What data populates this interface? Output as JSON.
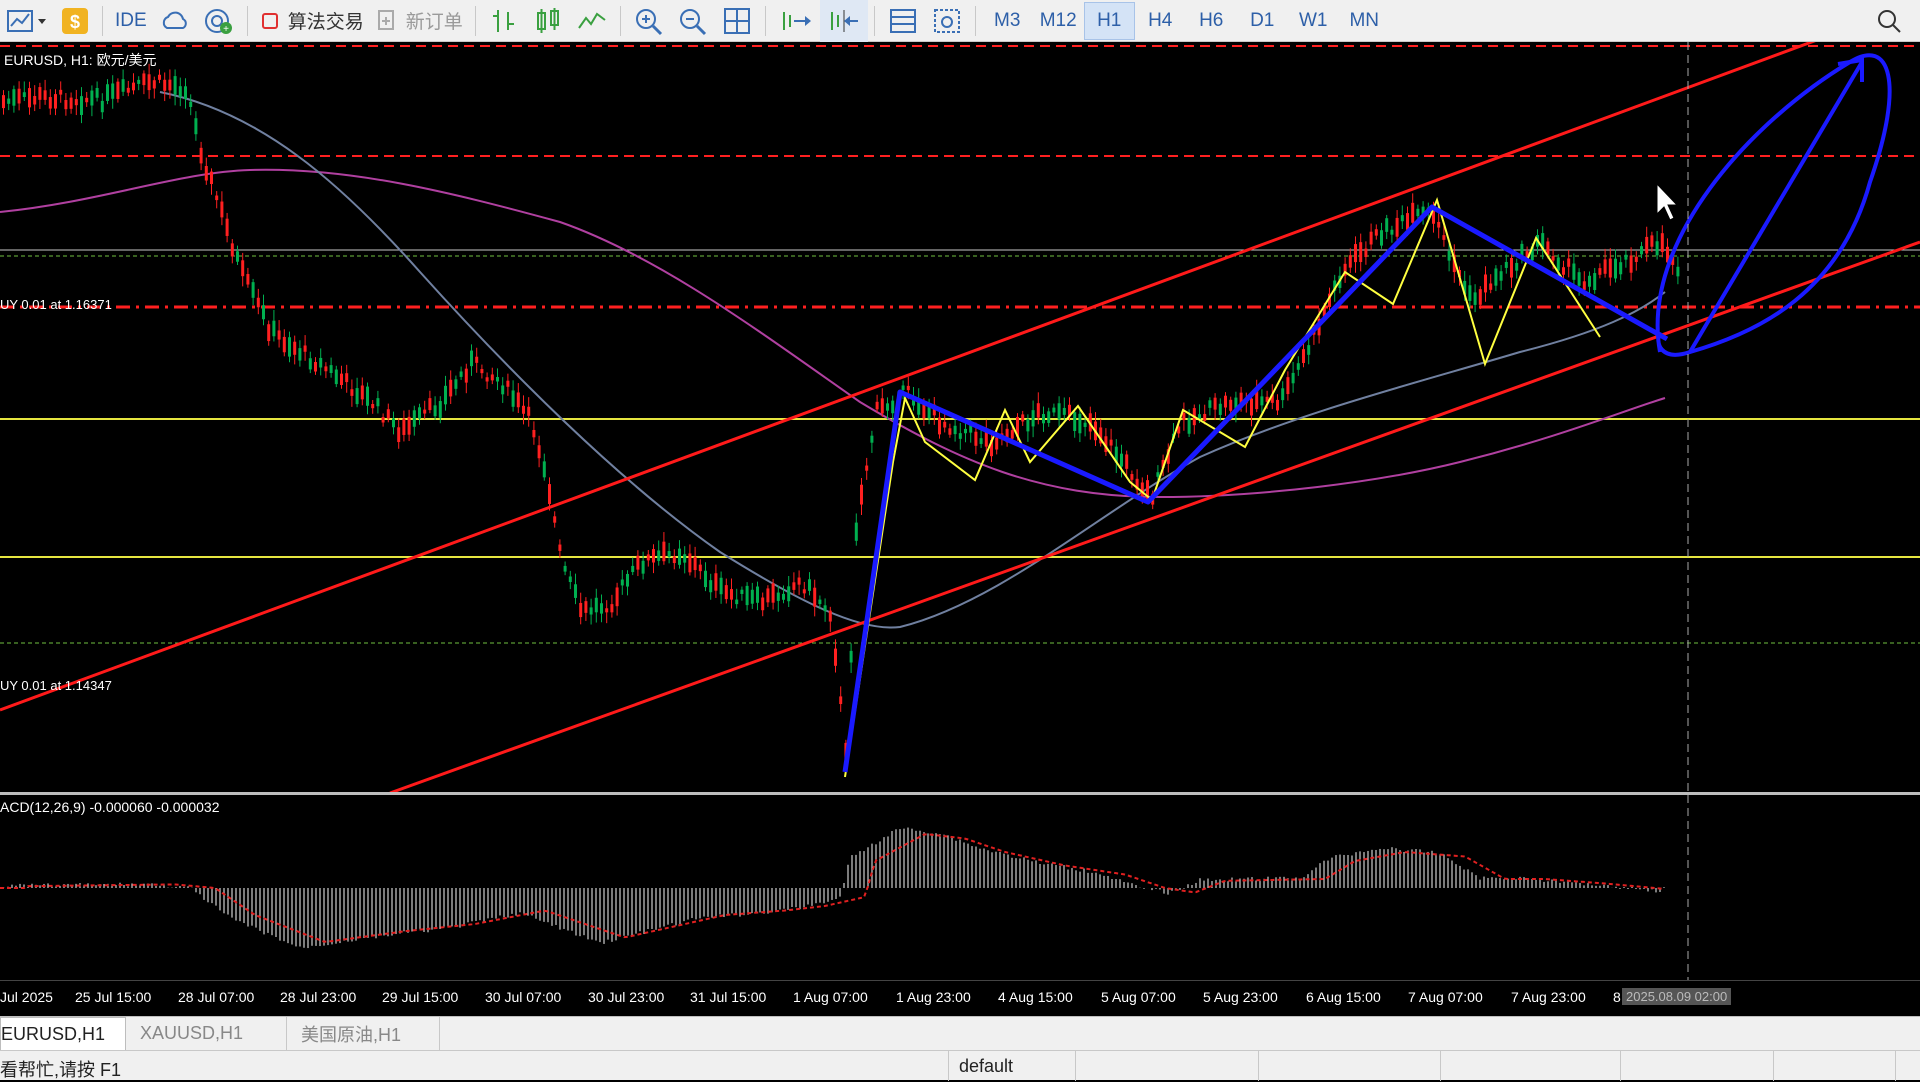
{
  "toolbar": {
    "ide_label": "IDE",
    "algo_trading_label": "算法交易",
    "new_order_label": "新订单",
    "timeframes": [
      "M3",
      "M12",
      "H1",
      "H4",
      "H6",
      "D1",
      "W1",
      "MN"
    ],
    "active_timeframe": "H1"
  },
  "chart": {
    "title": "EURUSD, H1:  欧元/美元",
    "order_labels": [
      "UY 0.01 at 1.16371",
      "UY 0.01 at 1.14347"
    ]
  },
  "macd": {
    "label": "ACD(12,26,9) -0.000060 -0.000032"
  },
  "time_axis": {
    "ticks": [
      "Jul 2025",
      "25 Jul 15:00",
      "28 Jul 07:00",
      "28 Jul 23:00",
      "29 Jul 15:00",
      "30 Jul 07:00",
      "30 Jul 23:00",
      "31 Jul 15:00",
      "1 Aug 07:00",
      "1 Aug 23:00",
      "4 Aug 15:00",
      "5 Aug 07:00",
      "5 Aug 23:00",
      "6 Aug 15:00",
      "7 Aug 07:00",
      "7 Aug 23:00",
      "8"
    ],
    "cursor_time": "2025.08.09 02:00"
  },
  "tabs": [
    "EURUSD,H1",
    "XAUUSD,H1",
    "美国原油,H1"
  ],
  "status": {
    "help": "看帮忙,请按 F1",
    "profile": "default"
  },
  "colors": {
    "bull_candle": "#00b050",
    "bear_candle": "#ff2020",
    "channel": "#ff1a1a",
    "zigzag_yellow": "#ffff40",
    "drawing_blue": "#1a1aff",
    "ma_fast": "#7080a0",
    "ma_slow": "#b040a0",
    "support_yellow": "#e6e640"
  }
}
